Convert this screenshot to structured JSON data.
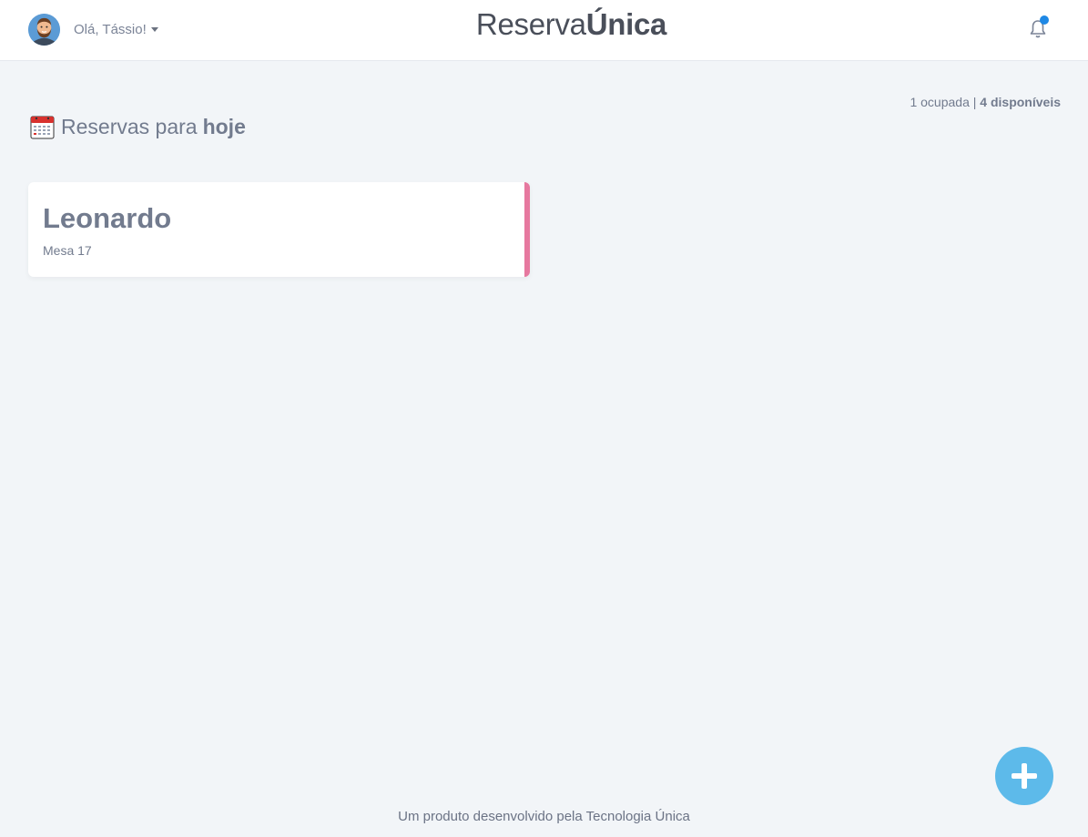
{
  "header": {
    "greeting": "Olá, Tássio!",
    "brand_regular": "Reserva",
    "brand_bold": "Única",
    "notification_dot_color": "#1e88e5"
  },
  "summary": {
    "occupied_text": "1 ocupada",
    "separator": " | ",
    "available_text": "4 disponíveis"
  },
  "section": {
    "title_prefix": "Reservas para",
    "title_bold": "hoje",
    "icon": "calendar-icon"
  },
  "reservations": [
    {
      "name": "Leonardo",
      "table": "Mesa 17",
      "accent_color": "#e6789f"
    }
  ],
  "fab": {
    "icon": "plus-icon",
    "color": "#5dbaea"
  },
  "footer": {
    "text": "Um produto desenvolvido pela Tecnologia Única"
  }
}
